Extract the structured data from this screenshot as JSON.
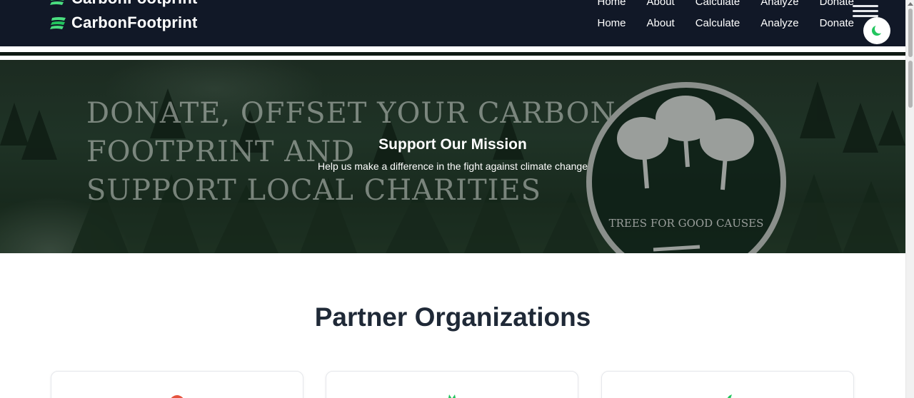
{
  "navbar": {
    "brand": "CarbonFootprint",
    "links": [
      "Home",
      "About",
      "Calculate",
      "Analyze",
      "Donate"
    ]
  },
  "hero": {
    "banner_lines": [
      "DONATE, OFFSET YOUR CARBON",
      "FOOTPRINT AND",
      "SUPPORT LOCAL CHARITIES"
    ],
    "logo_text": "TREES FOR GOOD CAUSES",
    "title": "Support Our Mission",
    "subtitle": "Help us make a difference in the fight against climate change"
  },
  "partners": {
    "title": "Partner Organizations",
    "cards": [
      {
        "logo_color": "#e5533d"
      },
      {
        "logo_color": "#22c55e"
      },
      {
        "logo_color": "#22c55e"
      }
    ]
  },
  "colors": {
    "navbar_bg": "#111827",
    "accent": "#22c55e",
    "hero_bg": "#1f3326",
    "heading": "#1f2937"
  },
  "icons": {
    "brand": "leaf-icon",
    "theme": "moon-icon",
    "menu": "menu-icon"
  }
}
